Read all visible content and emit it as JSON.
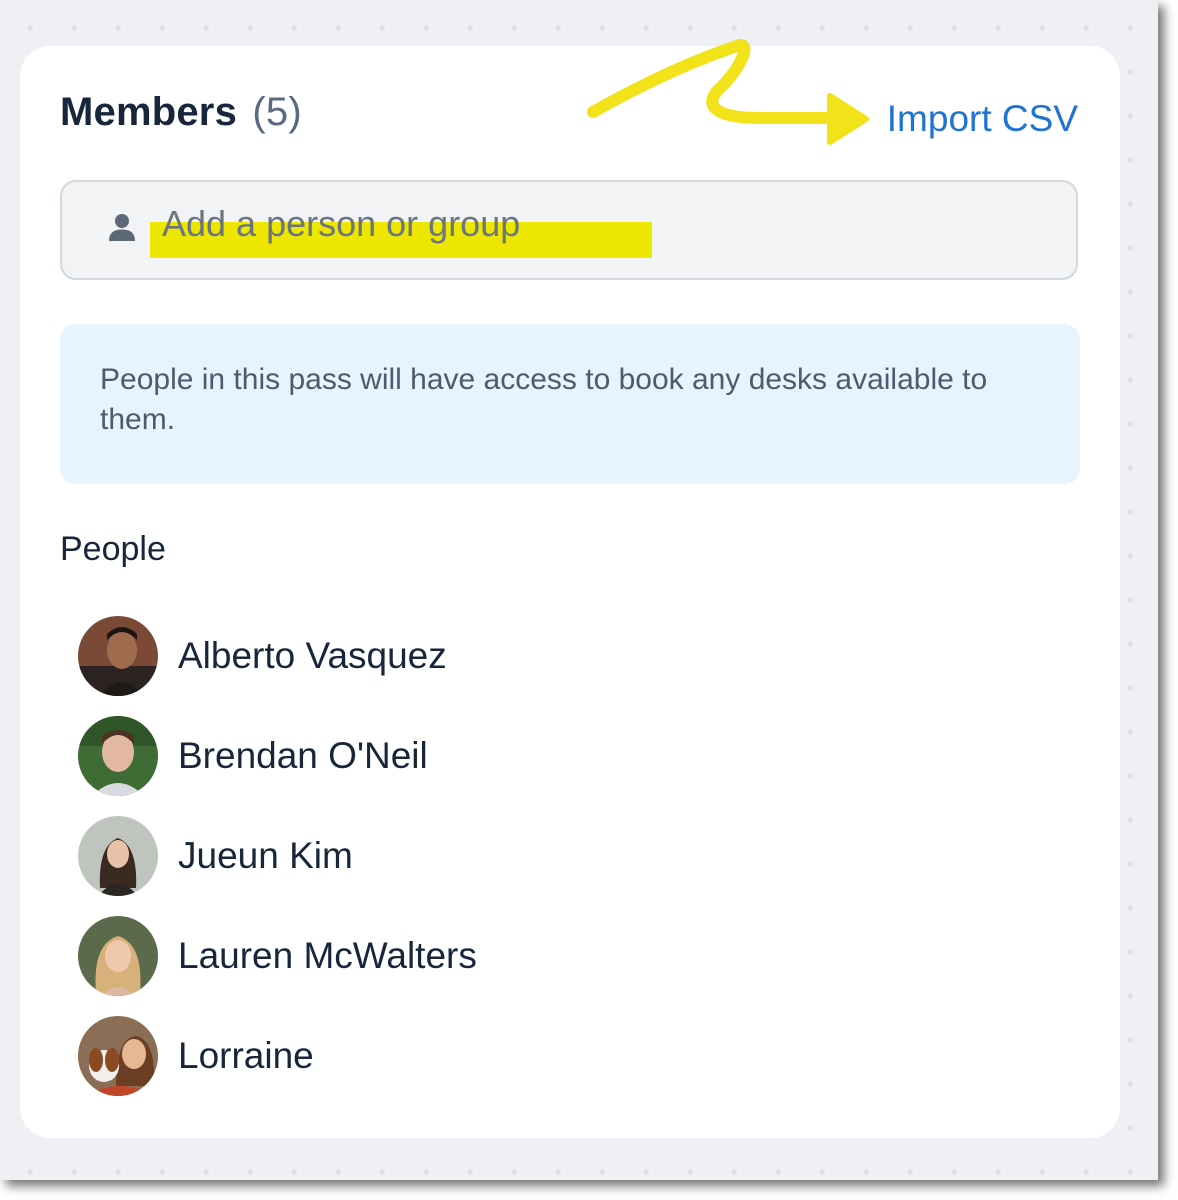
{
  "members": {
    "title": "Members",
    "count": "(5)",
    "import_label": "Import CSV"
  },
  "search": {
    "placeholder": "Add a person or group",
    "icon": "person-icon"
  },
  "info": {
    "text": "People in this pass will have access to book any desks available to them."
  },
  "people": {
    "heading": "People",
    "items": [
      {
        "name": "Alberto Vasquez"
      },
      {
        "name": "Brendan O'Neil"
      },
      {
        "name": "Jueun Kim"
      },
      {
        "name": "Lauren McWalters"
      },
      {
        "name": "Lorraine"
      }
    ]
  },
  "colors": {
    "accent_link": "#1f73d1",
    "highlight": "#ece600",
    "annotation_arrow": "#f2e21a",
    "info_bg": "#e7f4fd",
    "text_dark": "#17263a"
  }
}
